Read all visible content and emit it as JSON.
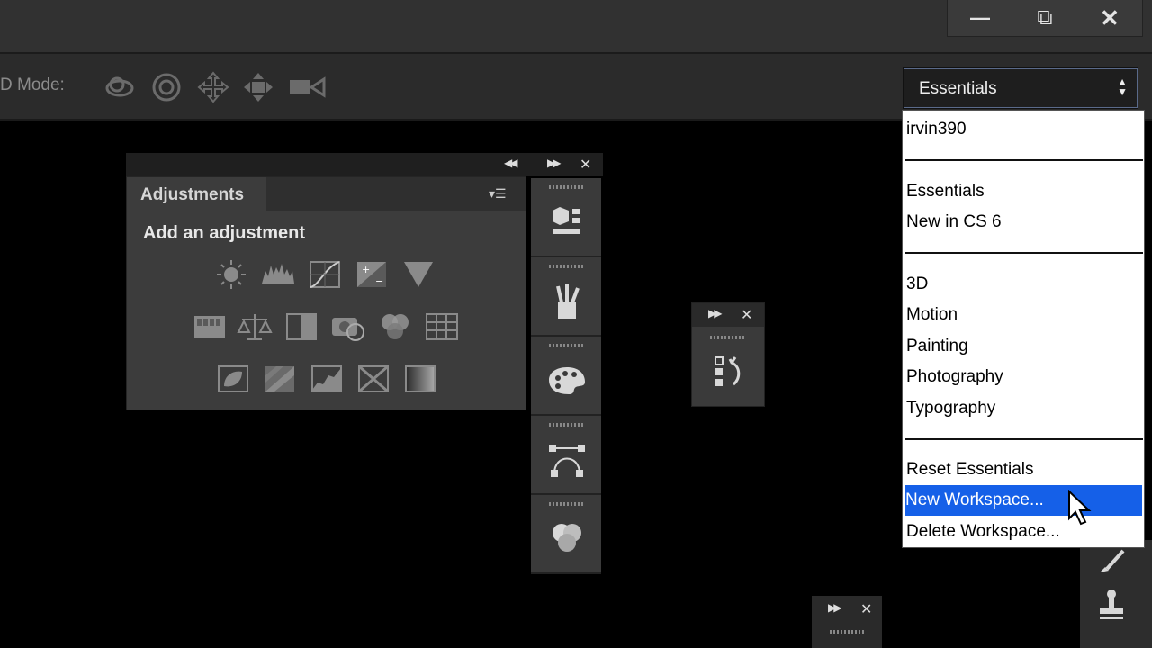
{
  "window_controls": {
    "minimize": "—",
    "restore": "⧉",
    "close": "✕"
  },
  "options_bar": {
    "mode_label": "D Mode:",
    "tools_3d": [
      "rotate-3d-icon",
      "roll-3d-icon",
      "drag-3d-icon",
      "slide-3d-icon",
      "scale-3d-video-icon"
    ]
  },
  "workspace": {
    "selected": "Essentials",
    "arrows_up": "▲",
    "arrows_down": "▼",
    "menu": {
      "groups": [
        [
          "irvin390"
        ],
        [
          "Essentials",
          "New in CS 6"
        ],
        [
          "3D",
          "Motion",
          "Painting",
          "Photography",
          "Typography"
        ],
        [
          "Reset Essentials",
          "New Workspace...",
          "Delete Workspace..."
        ]
      ],
      "highlighted": "New Workspace..."
    }
  },
  "adjustments_panel": {
    "tab_label": "Adjustments",
    "heading": "Add an adjustment",
    "collapse": "◀◀",
    "expand": "▶▶",
    "close": "✕",
    "menu": "▾☰",
    "icon_rows": [
      [
        "brightness-contrast-icon",
        "levels-icon",
        "curves-icon",
        "exposure-icon",
        "vibrance-icon"
      ],
      [
        "hue-saturation-icon",
        "color-balance-icon",
        "black-white-icon",
        "photo-filter-icon",
        "channel-mixer-icon",
        "color-lookup-icon"
      ],
      [
        "invert-icon",
        "posterize-icon",
        "threshold-icon",
        "selective-color-icon",
        "gradient-map-icon"
      ]
    ]
  },
  "dock": {
    "buttons": [
      "3d-panel-icon",
      "brush-presets-icon",
      "swatches-icon",
      "paths-icon",
      "channels-icon"
    ]
  },
  "history_panel": {
    "expand": "▶▶",
    "close": "✕",
    "icon": "history-icon"
  },
  "bottom_panel": {
    "expand": "▶▶",
    "close": "✕"
  },
  "colors": {
    "highlight": "#1560e8",
    "panel": "#3c3c3c",
    "chrome": "#313131"
  }
}
